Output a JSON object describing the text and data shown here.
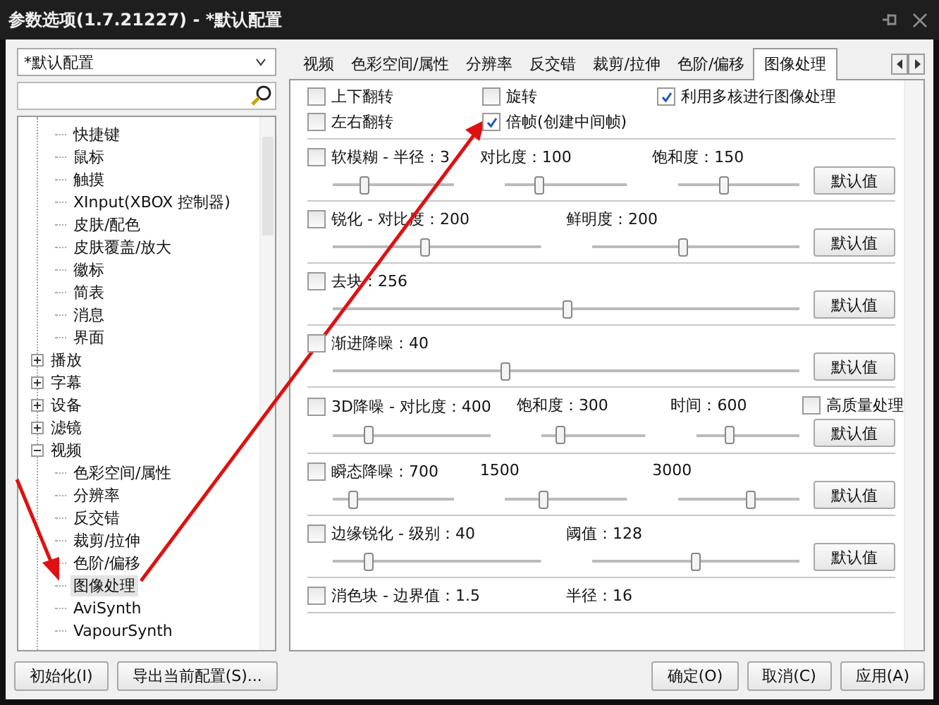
{
  "window": {
    "title": "参数选项(1.7.21227) - *默认配置"
  },
  "profile_select": {
    "value": "*默认配置"
  },
  "tree": {
    "items": [
      {
        "children": [
          {
            "label": "快捷键",
            "selected": false
          },
          {
            "label": "鼠标",
            "selected": false
          },
          {
            "label": "触摸",
            "selected": false
          },
          {
            "label": "XInput(XBOX 控制器)",
            "selected": false
          },
          {
            "label": "皮肤/配色",
            "selected": false
          },
          {
            "label": "皮肤覆盖/放大",
            "selected": false
          },
          {
            "label": "徽标",
            "selected": false
          },
          {
            "label": "简表",
            "selected": false
          },
          {
            "label": "消息",
            "selected": false
          },
          {
            "label": "界面",
            "selected": false
          }
        ]
      },
      {
        "label": "播放",
        "expanded": false,
        "selected": false
      },
      {
        "label": "字幕",
        "expanded": false,
        "selected": false
      },
      {
        "label": "设备",
        "expanded": false,
        "selected": false
      },
      {
        "label": "滤镜",
        "expanded": false,
        "selected": false
      },
      {
        "label": "视频",
        "expanded": true,
        "selected": false,
        "children": [
          {
            "label": "色彩空间/属性",
            "selected": false
          },
          {
            "label": "分辨率",
            "selected": false
          },
          {
            "label": "反交错",
            "selected": false
          },
          {
            "label": "裁剪/拉伸",
            "selected": false
          },
          {
            "label": "色阶/偏移",
            "selected": false
          },
          {
            "label": "图像处理",
            "selected": true
          },
          {
            "label": "AviSynth",
            "selected": false
          },
          {
            "label": "VapourSynth",
            "selected": false
          }
        ]
      }
    ]
  },
  "tabs": [
    {
      "label": "视频",
      "selected": false
    },
    {
      "label": "色彩空间/属性",
      "selected": false
    },
    {
      "label": "分辨率",
      "selected": false
    },
    {
      "label": "反交错",
      "selected": false
    },
    {
      "label": "裁剪/拉伸",
      "selected": false
    },
    {
      "label": "色阶/偏移",
      "selected": false
    },
    {
      "label": "图像处理",
      "selected": true
    }
  ],
  "options": [
    {
      "label": "上下翻转",
      "checked": false
    },
    {
      "label": "旋转",
      "checked": false
    },
    {
      "label": "利用多核进行图像处理",
      "checked": true
    },
    {
      "label": "左右翻转",
      "checked": false
    },
    {
      "label": "倍帧(创建中间帧)",
      "checked": true
    }
  ],
  "filters": [
    {
      "checked": false,
      "button": "默认值",
      "params": [
        {
          "label": "软模糊 - 半径：3",
          "level": 0.26
        },
        {
          "label": "对比度：100",
          "level": 0.27
        },
        {
          "label": "饱和度：150",
          "level": 0.38
        }
      ]
    },
    {
      "checked": false,
      "button": "默认值",
      "params": [
        {
          "label": "锐化 - 对比度：200",
          "level": 0.44
        },
        {
          "label": "鲜明度：200",
          "level": 0.44
        }
      ]
    },
    {
      "checked": false,
      "button": "默认值",
      "params": [
        {
          "label": "去块：256",
          "level": 0.5
        }
      ]
    },
    {
      "checked": false,
      "button": "默认值",
      "params": [
        {
          "label": "渐进降噪：40",
          "level": 0.37
        }
      ]
    },
    {
      "checked": false,
      "button": "默认值",
      "params": [
        {
          "label": "3D降噪 - 对比度：400",
          "level": 0.22
        },
        {
          "label": "饱和度：300",
          "level": 0.17
        },
        {
          "label": "时间：600",
          "level": 0.32
        }
      ],
      "option": {
        "label": "高质量处理",
        "checked": false
      }
    },
    {
      "checked": false,
      "button": "默认值",
      "params": [
        {
          "label": "瞬态降噪：700",
          "level": 0.16
        },
        {
          "label": "1500",
          "level": 0.31
        },
        {
          "label": "3000",
          "level": 0.6
        }
      ]
    },
    {
      "checked": false,
      "button": "默认值",
      "params": [
        {
          "label": "边缘锐化 - 级别：40",
          "level": 0.17
        },
        {
          "label": "阈值：128",
          "level": 0.5
        }
      ]
    },
    {
      "checked": false,
      "params": [
        {
          "label": "消色块 - 边界值：1.5"
        },
        {
          "label": "半径：16"
        }
      ]
    }
  ],
  "footer_left": [
    "初始化(I)",
    "导出当前配置(S)..."
  ],
  "footer_right": [
    "确定(O)",
    "取消(C)",
    "应用(A)"
  ]
}
